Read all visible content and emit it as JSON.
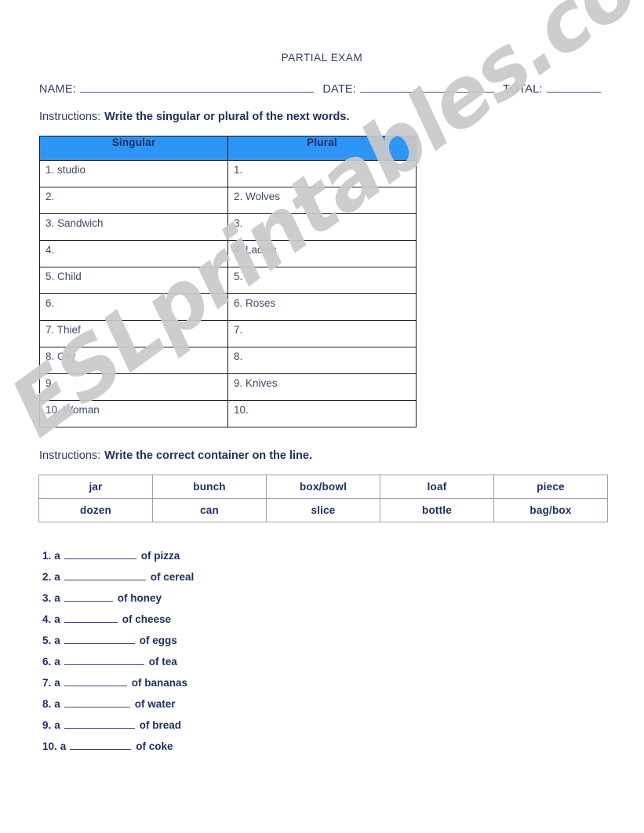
{
  "page": {
    "title": "PARTIAL EXAM",
    "watermark": "ESLprintables.com",
    "accent_color": "#2e94f5",
    "text_color": "#1d2f63",
    "watermark_color": "#c9c9c9"
  },
  "id_fields": {
    "name_label": "NAME:",
    "date_label": "DATE:",
    "total_label": "TOTAL:",
    "name_value": "",
    "date_value": "",
    "total_value": ""
  },
  "section1": {
    "instructions_lead": "Instructions:",
    "instructions_task": "Write the singular or plural of the next words.",
    "headers": [
      "Singular",
      "Plural"
    ],
    "rows": [
      {
        "singular": "1. studio",
        "plural": "1."
      },
      {
        "singular": "2.",
        "plural": "2. Wolves"
      },
      {
        "singular": "3. Sandwich",
        "plural": "3."
      },
      {
        "singular": "4.",
        "plural": "4. Ladies"
      },
      {
        "singular": "5. Child",
        "plural": "5."
      },
      {
        "singular": "6.",
        "plural": "6. Roses"
      },
      {
        "singular": "7. Thief",
        "plural": "7."
      },
      {
        "singular": "8. City",
        "plural": "8."
      },
      {
        "singular": "9.",
        "plural": "9. Knives"
      },
      {
        "singular": "10. Woman",
        "plural": "10."
      }
    ]
  },
  "section2": {
    "instructions_lead": "Instructions:",
    "instructions_task": "Write the correct container on the line.",
    "word_bank": [
      [
        "jar",
        "bunch",
        "box/bowl",
        "loaf",
        "piece"
      ],
      [
        "dozen",
        "can",
        "slice",
        "bottle",
        "bag/box"
      ]
    ],
    "items": [
      {
        "num": "1.",
        "article": "a",
        "blank_value": "",
        "object": "of pizza",
        "blank_width": 92
      },
      {
        "num": "2.",
        "article": "a",
        "blank_value": "",
        "object": "of cereal",
        "blank_width": 104
      },
      {
        "num": "3.",
        "article": "a",
        "blank_value": "",
        "object": "of honey",
        "blank_width": 62
      },
      {
        "num": "4.",
        "article": "a",
        "blank_value": "",
        "object": "of cheese",
        "blank_width": 68
      },
      {
        "num": "5.",
        "article": "a",
        "blank_value": "",
        "object": "of eggs",
        "blank_width": 90
      },
      {
        "num": "6.",
        "article": "a",
        "blank_value": "",
        "object": "of tea",
        "blank_width": 102
      },
      {
        "num": "7.",
        "article": "a",
        "blank_value": "",
        "object": "of bananas",
        "blank_width": 80
      },
      {
        "num": "8.",
        "article": "a",
        "blank_value": "",
        "object": "of water",
        "blank_width": 84
      },
      {
        "num": "9.",
        "article": "a",
        "blank_value": "",
        "object": "of bread",
        "blank_width": 90
      },
      {
        "num": "10.",
        "article": "a",
        "blank_value": "",
        "object": "of coke",
        "blank_width": 78
      }
    ]
  }
}
